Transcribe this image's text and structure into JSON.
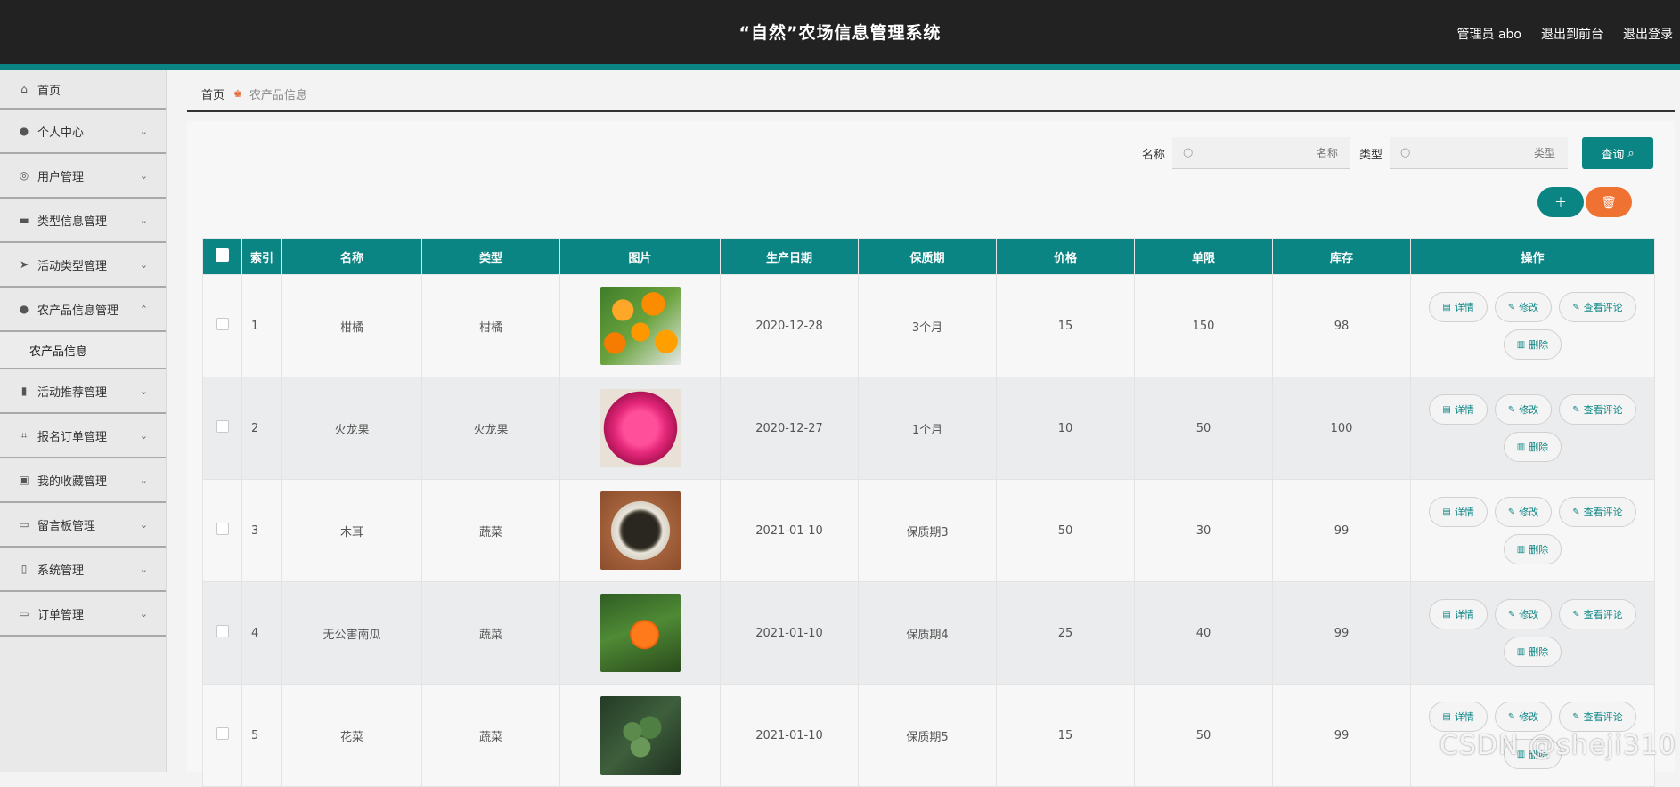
{
  "header": {
    "title": "“自然”农场信息管理系统",
    "user_label": "管理员 abo",
    "back_front_label": "退出到前台",
    "logout_label": "退出登录"
  },
  "sidebar": {
    "home": "首页",
    "items": [
      {
        "label": "个人中心",
        "icon": "person-icon"
      },
      {
        "label": "用户管理",
        "icon": "user-circle-icon"
      },
      {
        "label": "类型信息管理",
        "icon": "monitor-icon"
      },
      {
        "label": "活动类型管理",
        "icon": "send-icon"
      },
      {
        "label": "农产品信息管理",
        "icon": "location-pin-icon"
      },
      {
        "label": "活动推荐管理",
        "icon": "clipboard-icon"
      },
      {
        "label": "报名订单管理",
        "icon": "crop-icon"
      },
      {
        "label": "我的收藏管理",
        "icon": "chart-icon"
      },
      {
        "label": "留言板管理",
        "icon": "chat-icon"
      },
      {
        "label": "系统管理",
        "icon": "mic-icon"
      },
      {
        "label": "订单管理",
        "icon": "card-icon"
      }
    ],
    "sub_item": "农产品信息"
  },
  "breadcrumb": {
    "home": "首页",
    "current": "农产品信息"
  },
  "search": {
    "name_label": "名称",
    "name_placeholder": "名称",
    "type_label": "类型",
    "type_placeholder": "类型",
    "query_label": "查询"
  },
  "table": {
    "columns": [
      "索引",
      "名称",
      "类型",
      "图片",
      "生产日期",
      "保质期",
      "价格",
      "单限",
      "库存",
      "操作"
    ],
    "rows": [
      {
        "index": "1",
        "name": "柑橘",
        "type": "柑橘",
        "image": "orange",
        "date": "2020-12-28",
        "shelf": "3个月",
        "price": "15",
        "limit": "150",
        "stock": "98"
      },
      {
        "index": "2",
        "name": "火龙果",
        "type": "火龙果",
        "image": "dragonfruit",
        "date": "2020-12-27",
        "shelf": "1个月",
        "price": "10",
        "limit": "50",
        "stock": "100"
      },
      {
        "index": "3",
        "name": "木耳",
        "type": "蔬菜",
        "image": "fungus",
        "date": "2021-01-10",
        "shelf": "保质期3",
        "price": "50",
        "limit": "30",
        "stock": "99"
      },
      {
        "index": "4",
        "name": "无公害南瓜",
        "type": "蔬菜",
        "image": "pumpkin",
        "date": "2021-01-10",
        "shelf": "保质期4",
        "price": "25",
        "limit": "40",
        "stock": "99"
      },
      {
        "index": "5",
        "name": "花菜",
        "type": "蔬菜",
        "image": "broccoli",
        "date": "2021-01-10",
        "shelf": "保质期5",
        "price": "15",
        "limit": "50",
        "stock": "99"
      }
    ],
    "actions": {
      "detail": "详情",
      "edit": "修改",
      "comments": "查看评论",
      "delete": "删除"
    }
  },
  "watermark": "CSDN @sheji310",
  "colors": {
    "primary": "#0b8584",
    "danger": "#f07232",
    "header_bg": "#222222"
  }
}
